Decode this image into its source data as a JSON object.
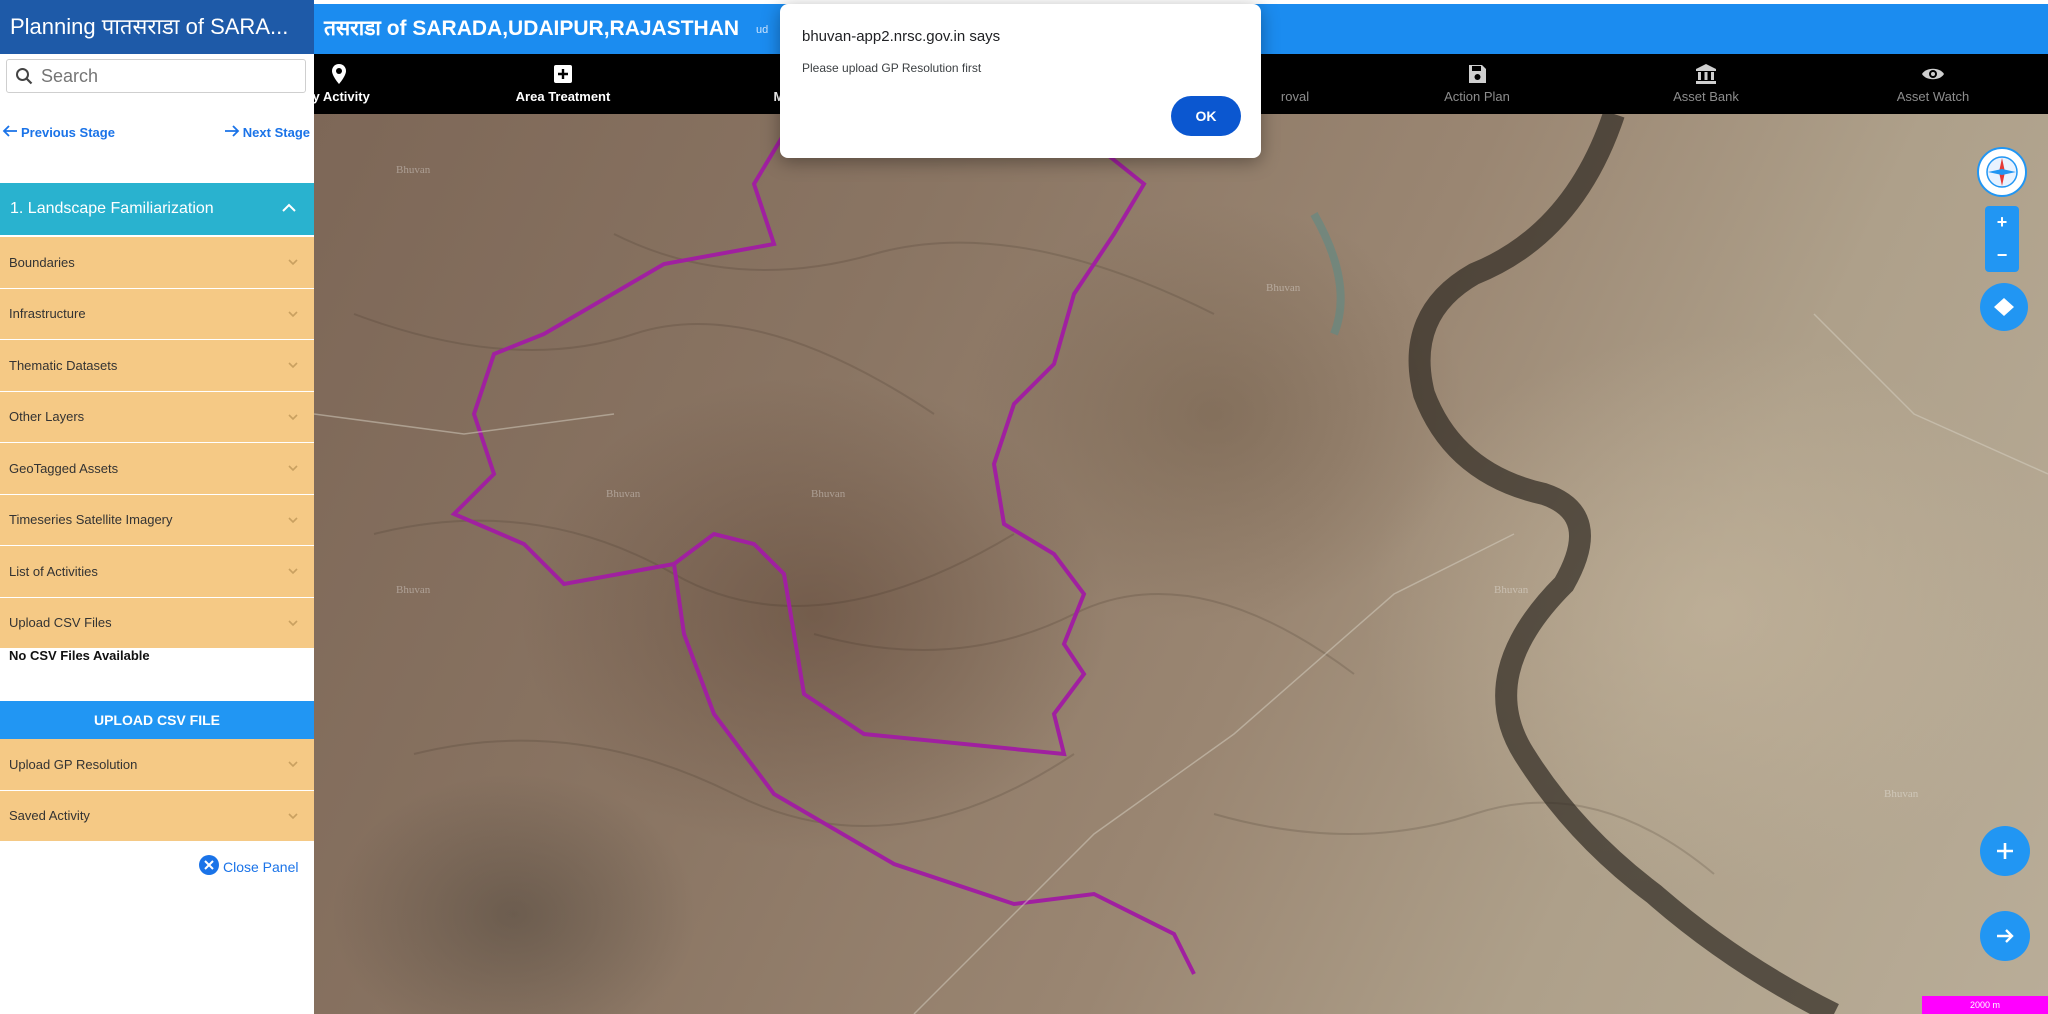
{
  "app": {
    "sidebar_title": "Planning पातसराडा of SARA...",
    "page_title": "तसराडा of SARADA,UDAIPUR,RAJASTHAN",
    "page_subtitle": "ud"
  },
  "search": {
    "placeholder": "Search"
  },
  "stage_nav": {
    "prev_label": "Previous Stage",
    "next_label": "Next Stage"
  },
  "section": {
    "title": "1. Landscape Familiarization"
  },
  "layers": [
    {
      "label": "Boundaries"
    },
    {
      "label": "Infrastructure"
    },
    {
      "label": "Thematic Datasets"
    },
    {
      "label": "Other Layers"
    },
    {
      "label": "GeoTagged Assets"
    },
    {
      "label": "Timeseries Satellite Imagery"
    },
    {
      "label": "List of Activities"
    },
    {
      "label": "Upload CSV Files"
    }
  ],
  "csv": {
    "empty_text": "No CSV Files Available",
    "upload_button": "UPLOAD CSV FILE"
  },
  "lower_items": [
    {
      "label": "Upload GP Resolution"
    },
    {
      "label": "Saved Activity"
    }
  ],
  "close_panel": "Close Panel",
  "toolbar": {
    "items": [
      {
        "label": "ty Activity",
        "icon": "map-pin-icon"
      },
      {
        "label": "Area Treatment",
        "icon": "plus-square-icon"
      },
      {
        "label": "Map C",
        "icon": "map-icon"
      },
      {
        "label": "roval",
        "icon": "check-icon"
      },
      {
        "label": "Action Plan",
        "icon": "save-icon"
      },
      {
        "label": "Asset Bank",
        "icon": "bank-icon"
      },
      {
        "label": "Asset Watch",
        "icon": "eye-icon"
      }
    ]
  },
  "dialog": {
    "title": "bhuvan-app2.nrsc.gov.in says",
    "message": "Please upload GP Resolution first",
    "ok_label": "OK"
  },
  "map": {
    "boundary_color": "#a020a0",
    "watermark": "Bhuvan",
    "scale_text": "2000 m"
  },
  "colors": {
    "accent": "#2196f3",
    "section_head": "#29b2cf",
    "accordion": "#f5c985",
    "title_blue": "#1e5aa8"
  }
}
